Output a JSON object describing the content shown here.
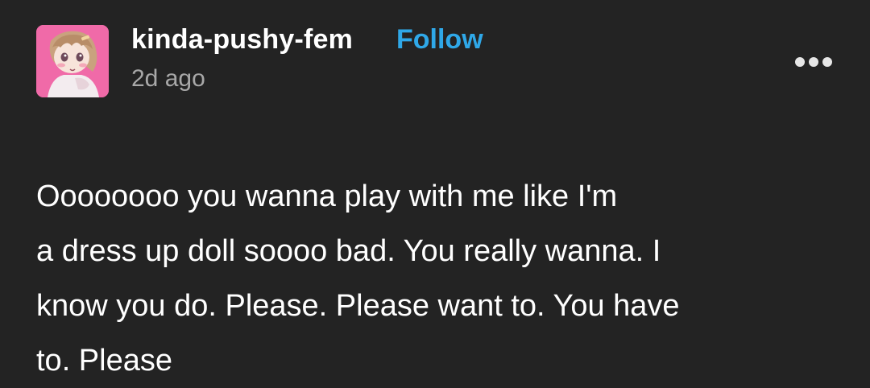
{
  "post": {
    "author": {
      "username": "kinda-pushy-fem",
      "avatar_icon": "anime-avatar-image"
    },
    "follow_label": "Follow",
    "timestamp": "2d ago",
    "more_icon": "more-options-icon",
    "body_lines": [
      "Oooooooo you wanna play with me like I'm",
      "a dress up doll soooo bad. You really wanna. I",
      "know you do. Please. Please want to. You have",
      "to. Please"
    ]
  },
  "colors": {
    "background": "#232323",
    "text": "#ffffff",
    "accent": "#2fa8e8",
    "muted": "#a8a8a8",
    "avatar_bg": "#f06aa8"
  }
}
